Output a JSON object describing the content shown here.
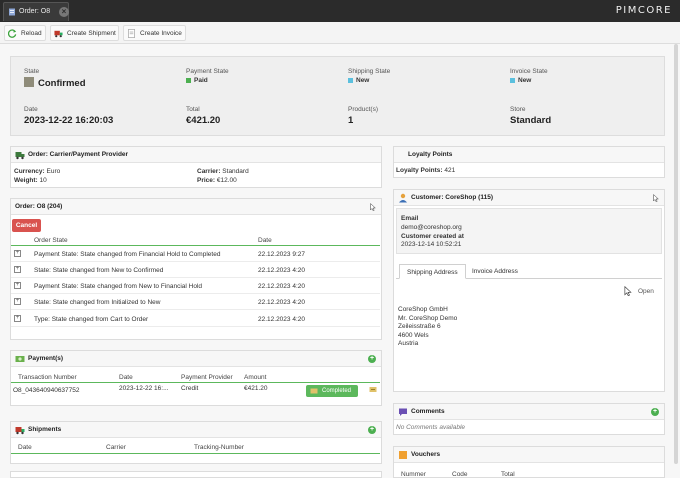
{
  "tab": {
    "label": "Order: O8",
    "close": "×"
  },
  "brand": {
    "logo": "PIMCORE"
  },
  "toolbar": {
    "reload": "Reload",
    "create_shipment": "Create Shipment",
    "create_invoice": "Create Invoice"
  },
  "summary": {
    "state_label": "State",
    "state_value": "Confirmed",
    "payment_state_label": "Payment State",
    "payment_state_value": "Paid",
    "shipping_state_label": "Shipping State",
    "shipping_state_value": "New",
    "invoice_state_label": "Invoice State",
    "invoice_state_value": "New",
    "date_label": "Date",
    "date_value": "2023-12-22 16:20:03",
    "total_label": "Total",
    "total_value": "€421.20",
    "products_label": "Product(s)",
    "products_value": "1",
    "store_label": "Store",
    "store_value": "Standard"
  },
  "carrier_panel": {
    "title": "Order: Carrier/Payment Provider",
    "currency_label": "Currency:",
    "currency_value": "Euro",
    "weight_label": "Weight:",
    "weight_value": "10",
    "carrier_label": "Carrier:",
    "carrier_value": "Standard",
    "price_label": "Price:",
    "price_value": "€12.00"
  },
  "history_panel": {
    "title": "Order: O8 (204)",
    "cancel": "Cancel",
    "col_state": "Order State",
    "col_date": "Date",
    "rows": [
      {
        "expand": "+",
        "state": "Payment State: State changed from Financial Hold to Completed",
        "date": "22.12.2023 9:27"
      },
      {
        "expand": "+",
        "state": "State: State changed from New to Confirmed",
        "date": "22.12.2023 4:20"
      },
      {
        "expand": "+",
        "state": "Payment State: State changed from New to Financial Hold",
        "date": "22.12.2023 4:20"
      },
      {
        "expand": "+",
        "state": "State: State changed from Initialized to New",
        "date": "22.12.2023 4:20"
      },
      {
        "expand": "+",
        "state": "Type: State changed from Cart to Order",
        "date": "22.12.2023 4:20"
      }
    ]
  },
  "payments_panel": {
    "title": "Payment(s)",
    "add": "+",
    "col_tx": "Transaction Number",
    "col_date": "Date",
    "col_provider": "Payment Provider",
    "col_amount": "Amount",
    "row": {
      "tx": "O8_043640940637752",
      "date": "2023-12-22 16:...",
      "provider": "Credit",
      "amount": "€421.20",
      "status": "Completed"
    }
  },
  "shipments_panel": {
    "title": "Shipments",
    "add": "+",
    "col_date": "Date",
    "col_carrier": "Carrier",
    "col_tracking": "Tracking-Number"
  },
  "loyalty_panel": {
    "title": "Loyalty Points",
    "label": "Loyalty Points:",
    "value": "421"
  },
  "customer_panel": {
    "title": "Customer: CoreShop (115)",
    "email_label": "Email",
    "email_value": "demo@coreshop.org",
    "created_label": "Customer created at",
    "created_value": "2023-12-14 10:52:21",
    "tab_shipping": "Shipping Address",
    "tab_invoice": "Invoice Address",
    "open": "Open",
    "address": [
      "CoreShop GmbH",
      "Mr. CoreShop Demo",
      "Zeileisstraße 6",
      "4600 Wels",
      "Austria"
    ]
  },
  "comments_panel": {
    "title": "Comments",
    "add": "+",
    "empty": "No Comments available"
  },
  "vouchers_panel": {
    "title": "Vouchers",
    "col_number": "Nummer",
    "col_code": "Code",
    "col_total": "Total"
  },
  "colors": {
    "paid": "#4caf50",
    "new": "#5bc0de",
    "state": "#8f8c7a",
    "cancel": "#d9534f"
  }
}
